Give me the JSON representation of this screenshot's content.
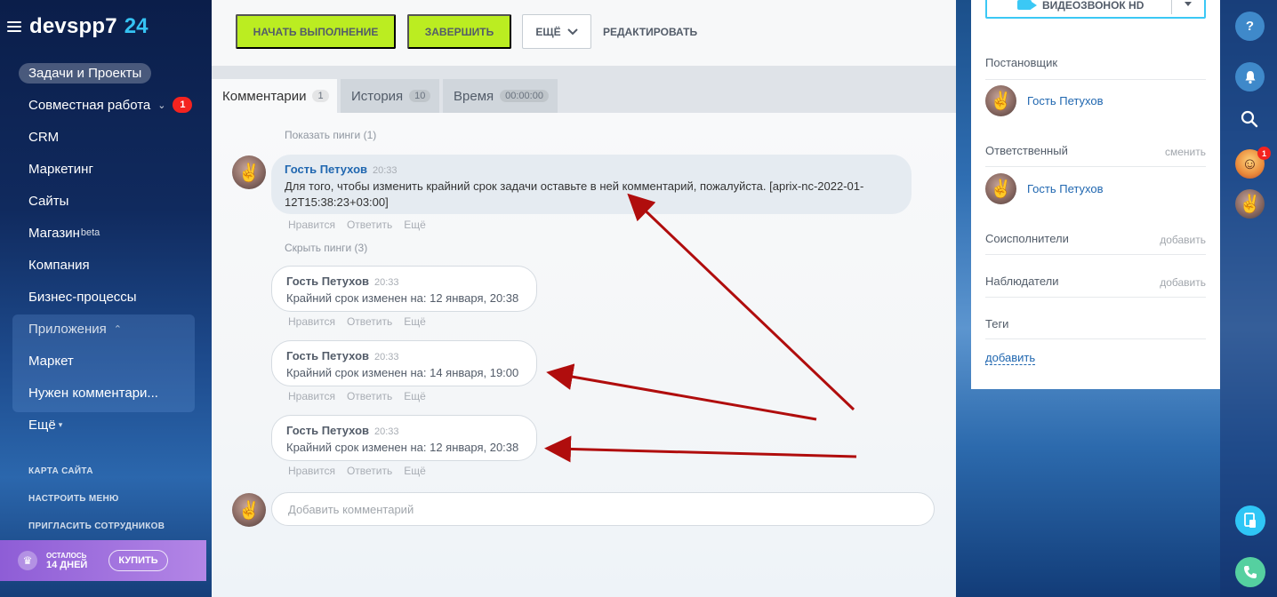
{
  "logo": {
    "name": "devspp7",
    "num": "24"
  },
  "sidebar": {
    "items": [
      {
        "label": "Задачи и Проекты"
      },
      {
        "label": "Совместная работа",
        "badge": "1"
      },
      {
        "label": "CRM"
      },
      {
        "label": "Маркетинг"
      },
      {
        "label": "Сайты"
      },
      {
        "label": "Магазин",
        "sup": "beta"
      },
      {
        "label": "Компания"
      },
      {
        "label": "Бизнес-процессы"
      },
      {
        "label": "Приложения"
      },
      {
        "label": "Маркет"
      },
      {
        "label": "Нужен комментари..."
      },
      {
        "label": "Ещё"
      }
    ],
    "links": [
      "КАРТА САЙТА",
      "НАСТРОИТЬ МЕНЮ",
      "ПРИГЛАСИТЬ СОТРУДНИКОВ"
    ],
    "trial": {
      "line1": "ОСТАЛОСЬ",
      "line2": "14 ДНЕЙ",
      "buy": "КУПИТЬ"
    }
  },
  "toolbar": {
    "start": "НАЧАТЬ ВЫПОЛНЕНИЕ",
    "finish": "ЗАВЕРШИТЬ",
    "more": "ЕЩЁ",
    "edit": "РЕДАКТИРОВАТЬ"
  },
  "tabs": [
    {
      "label": "Комментарии",
      "count": "1"
    },
    {
      "label": "История",
      "count": "10"
    },
    {
      "label": "Время",
      "count": "00:00:00"
    }
  ],
  "feed": {
    "show_pings": "Показать пинги (1)",
    "hide_pings": "Скрыть пинги (3)",
    "actions": [
      "Нравится",
      "Ответить",
      "Ещё"
    ],
    "comments": [
      {
        "author": "Гость Петухов",
        "time": "20:33",
        "text": "Для того, чтобы изменить крайний срок задачи оставьте в ней комментарий, пожалуйста. [aprix-nc-2022-01-12T15:38:23+03:00]"
      },
      {
        "author": "Гость Петухов",
        "time": "20:33",
        "text": "Крайний срок изменен на: 12 января, 20:38"
      },
      {
        "author": "Гость Петухов",
        "time": "20:33",
        "text": "Крайний срок изменен на: 14 января, 19:00"
      },
      {
        "author": "Гость Петухов",
        "time": "20:33",
        "text": "Крайний срок изменен на: 12 января, 20:38"
      }
    ],
    "add_placeholder": "Добавить комментарий"
  },
  "right_panel": {
    "video_button": "ВИДЕОЗВОНОК HD",
    "creator_label": "Постановщик",
    "creator_name": "Гость Петухов",
    "responsible_label": "Ответственный",
    "responsible_change": "сменить",
    "responsible_name": "Гость Петухов",
    "coexecutors_label": "Соисполнители",
    "coexecutors_add": "добавить",
    "observers_label": "Наблюдатели",
    "observers_add": "добавить",
    "tags_label": "Теги",
    "tags_add": "добавить"
  },
  "right_bar": {
    "help": "?",
    "notification_badge": "1"
  },
  "colors": {
    "accent_green": "#bbed21",
    "link_blue": "#2067b0",
    "badge_red": "#f4231f",
    "arrow_red": "#b00d0d"
  }
}
